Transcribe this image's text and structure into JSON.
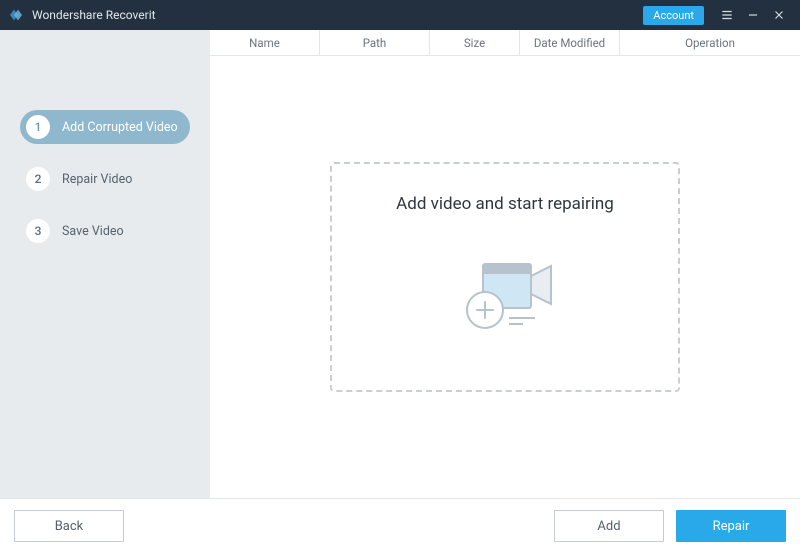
{
  "titlebar": {
    "app_name": "Wondershare Recoverit",
    "account_label": "Account"
  },
  "sidebar": {
    "steps": [
      {
        "num": "1",
        "label": "Add Corrupted Video",
        "active": true
      },
      {
        "num": "2",
        "label": "Repair Video",
        "active": false
      },
      {
        "num": "3",
        "label": "Save Video",
        "active": false
      }
    ]
  },
  "columns": {
    "name": "Name",
    "path": "Path",
    "size": "Size",
    "date_modified": "Date Modified",
    "operation": "Operation"
  },
  "dropzone": {
    "headline": "Add video and start repairing"
  },
  "footer": {
    "back": "Back",
    "add": "Add",
    "repair": "Repair"
  }
}
